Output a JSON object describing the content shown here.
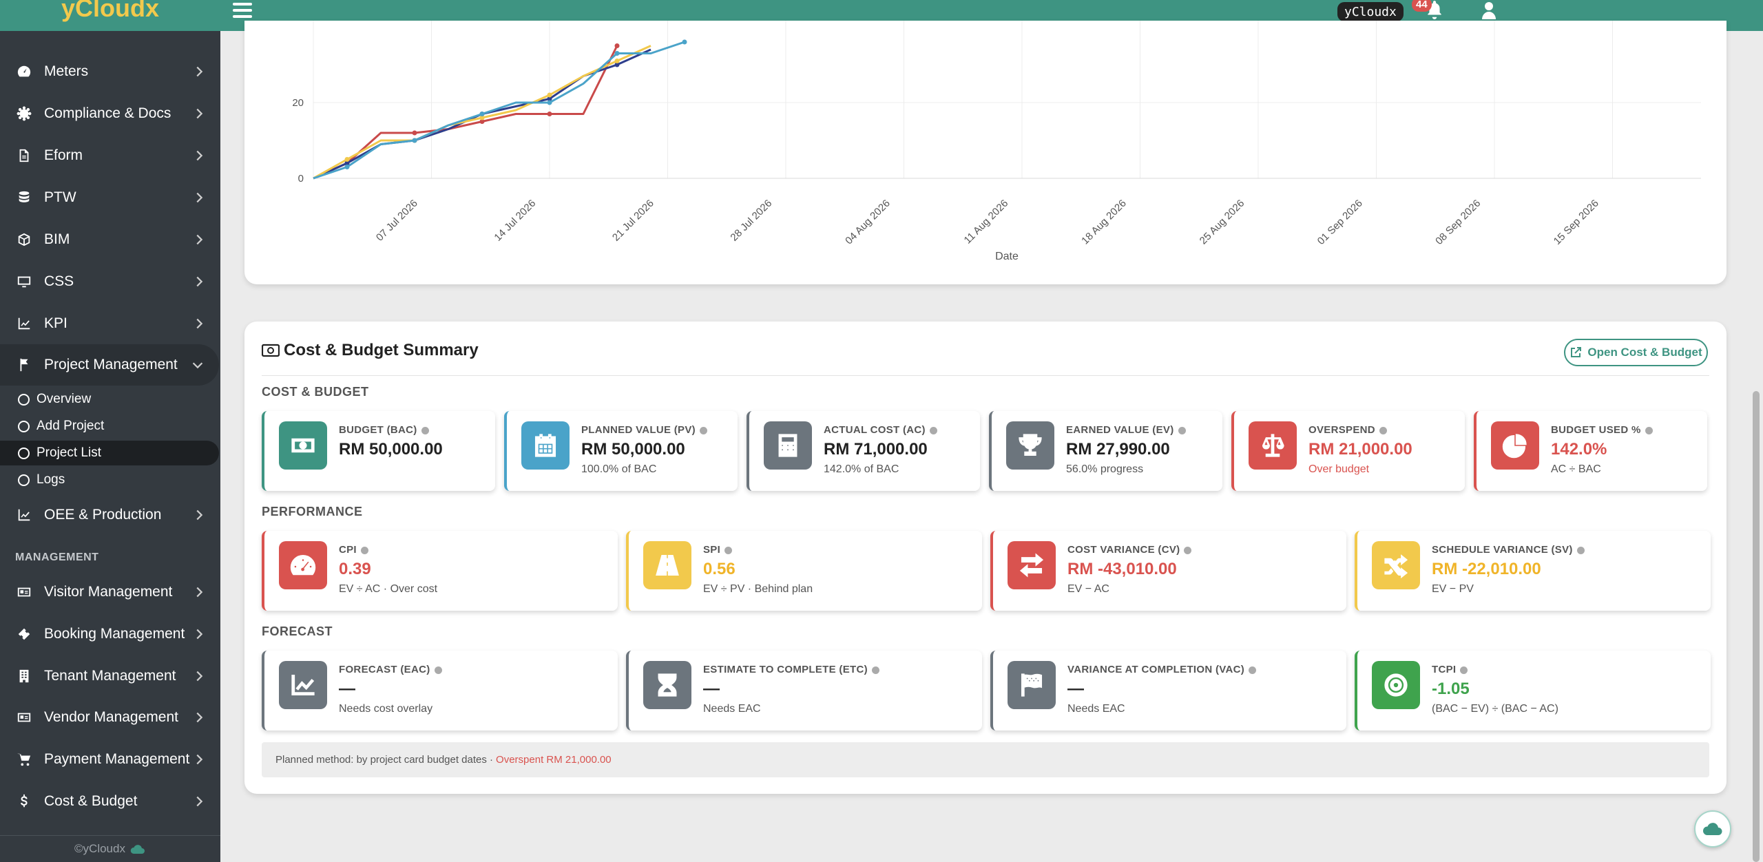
{
  "app": {
    "brand": "yCloudx"
  },
  "topbar": {
    "brand_tag": "yCloudx",
    "notification_count": "44"
  },
  "sidebar": {
    "items": [
      {
        "label": "Meters",
        "icon": "gauge-icon"
      },
      {
        "label": "Compliance & Docs",
        "icon": "gear-badge-icon"
      },
      {
        "label": "Eform",
        "icon": "document-icon"
      },
      {
        "label": "PTW",
        "icon": "database-icon"
      },
      {
        "label": "BIM",
        "icon": "cube-icon"
      },
      {
        "label": "CSS",
        "icon": "monitor-icon"
      },
      {
        "label": "KPI",
        "icon": "line-chart-icon"
      },
      {
        "label": "Project Management",
        "icon": "flag-icon"
      }
    ],
    "sub_items": [
      {
        "label": "Overview"
      },
      {
        "label": "Add Project"
      },
      {
        "label": "Project List"
      },
      {
        "label": "Logs"
      }
    ],
    "oee": {
      "label": "OEE & Production",
      "icon": "line-chart-icon"
    },
    "management_header": "MANAGEMENT",
    "management_items": [
      {
        "label": "Visitor Management",
        "icon": "id-card-icon"
      },
      {
        "label": "Booking Management",
        "icon": "ticket-icon"
      },
      {
        "label": "Tenant Management",
        "icon": "building-icon"
      },
      {
        "label": "Vendor Management",
        "icon": "vendor-card-icon"
      },
      {
        "label": "Payment Management",
        "icon": "cart-icon"
      },
      {
        "label": "Cost & Budget",
        "icon": "dollar-icon"
      }
    ],
    "footer": "©yCloudx"
  },
  "chart_data": {
    "type": "line",
    "xlabel": "Date",
    "x_ticks": [
      "07 Jul 2026",
      "14 Jul 2026",
      "21 Jul 2026",
      "28 Jul 2026",
      "04 Aug 2026",
      "11 Aug 2026",
      "18 Aug 2026",
      "25 Aug 2026",
      "01 Sep 2026",
      "08 Sep 2026",
      "15 Sep 2026"
    ],
    "y_ticks": [
      0,
      20
    ],
    "colors": [
      "#c94a4a",
      "#2e3e8c",
      "#f2c94c",
      "#4aa3c9"
    ],
    "series": [
      {
        "color": "#c94a4a",
        "points": [
          [
            0,
            0
          ],
          [
            1,
            4
          ],
          [
            2,
            12
          ],
          [
            3,
            12
          ],
          [
            4,
            13
          ],
          [
            5,
            15
          ],
          [
            6,
            17
          ],
          [
            7,
            17
          ],
          [
            8,
            17
          ],
          [
            9,
            35
          ]
        ]
      },
      {
        "color": "#2e3e8c",
        "points": [
          [
            0,
            0
          ],
          [
            1,
            4
          ],
          [
            2,
            9
          ],
          [
            3,
            10
          ],
          [
            4,
            13
          ],
          [
            5,
            17
          ],
          [
            6,
            19
          ],
          [
            7,
            21
          ],
          [
            8,
            27
          ],
          [
            9,
            30
          ],
          [
            10,
            34
          ]
        ]
      },
      {
        "color": "#f2c94c",
        "points": [
          [
            0,
            0
          ],
          [
            1,
            5
          ],
          [
            2,
            10
          ],
          [
            3,
            10
          ],
          [
            4,
            14
          ],
          [
            5,
            16
          ],
          [
            6,
            18
          ],
          [
            7,
            22
          ],
          [
            8,
            27
          ],
          [
            9,
            31
          ],
          [
            10,
            35
          ]
        ]
      },
      {
        "color": "#4aa3c9",
        "points": [
          [
            0,
            0
          ],
          [
            1,
            3
          ],
          [
            2,
            9
          ],
          [
            3,
            10
          ],
          [
            4,
            14
          ],
          [
            5,
            17
          ],
          [
            6,
            20
          ],
          [
            7,
            20
          ],
          [
            8,
            25
          ],
          [
            9,
            33
          ],
          [
            10,
            33
          ],
          [
            11,
            36
          ]
        ]
      }
    ]
  },
  "summary": {
    "title": "Cost & Budget Summary",
    "open_button": "Open Cost & Budget",
    "sections": {
      "cost": "COST & BUDGET",
      "performance": "PERFORMANCE",
      "forecast": "FORECAST"
    },
    "cost_cards": [
      {
        "label": "BUDGET (BAC)",
        "value": "RM 50,000.00",
        "sub": "",
        "color": "#3e9482",
        "icon": "money-icon"
      },
      {
        "label": "PLANNED VALUE (PV)",
        "value": "RM 50,000.00",
        "sub": "100.0% of BAC",
        "color": "#4aa3c9",
        "icon": "calendar-icon"
      },
      {
        "label": "ACTUAL COST (AC)",
        "value": "RM 71,000.00",
        "sub": "142.0% of BAC",
        "color": "#6c757d",
        "icon": "calculator-icon"
      },
      {
        "label": "EARNED VALUE (EV)",
        "value": "RM 27,990.00",
        "sub": "56.0% progress",
        "color": "#6c757d",
        "icon": "trophy-icon"
      },
      {
        "label": "OVERSPEND",
        "value": "RM 21,000.00",
        "sub": "Over budget",
        "color": "#d9534f",
        "icon": "scale-icon"
      },
      {
        "label": "BUDGET USED %",
        "value": "142.0%",
        "sub": "AC ÷ BAC",
        "color": "#d9534f",
        "icon": "pie-chart-icon"
      }
    ],
    "performance_cards": [
      {
        "label": "CPI",
        "value": "0.39",
        "sub": "EV ÷ AC · Over cost",
        "color": "#d9534f",
        "icon": "speedometer-icon"
      },
      {
        "label": "SPI",
        "value": "0.56",
        "sub": "EV ÷ PV · Behind plan",
        "color": "#f2c94c",
        "icon": "road-icon"
      },
      {
        "label": "COST VARIANCE (CV)",
        "value": "RM -43,010.00",
        "sub": "EV − AC",
        "color": "#d9534f",
        "icon": "exchange-icon"
      },
      {
        "label": "SCHEDULE VARIANCE (SV)",
        "value": "RM -22,010.00",
        "sub": "EV − PV",
        "color": "#f2c94c",
        "icon": "shuffle-icon"
      }
    ],
    "forecast_cards": [
      {
        "label": "FORECAST (EAC)",
        "value": "—",
        "sub": "Needs cost overlay",
        "color": "#6c757d",
        "icon": "trend-up-icon"
      },
      {
        "label": "ESTIMATE TO COMPLETE (ETC)",
        "value": "—",
        "sub": "Needs EAC",
        "color": "#6c757d",
        "icon": "hourglass-icon"
      },
      {
        "label": "VARIANCE AT COMPLETION (VAC)",
        "value": "—",
        "sub": "Needs EAC",
        "color": "#6c757d",
        "icon": "flags-icon"
      },
      {
        "label": "TCPI",
        "value": "-1.05",
        "sub": "(BAC − EV) ÷ (BAC − AC)",
        "color": "#3fa34d",
        "icon": "target-icon"
      }
    ],
    "note": {
      "text": "Planned method: by project card budget dates ·",
      "highlight": "Overspent RM 21,000.00"
    }
  }
}
